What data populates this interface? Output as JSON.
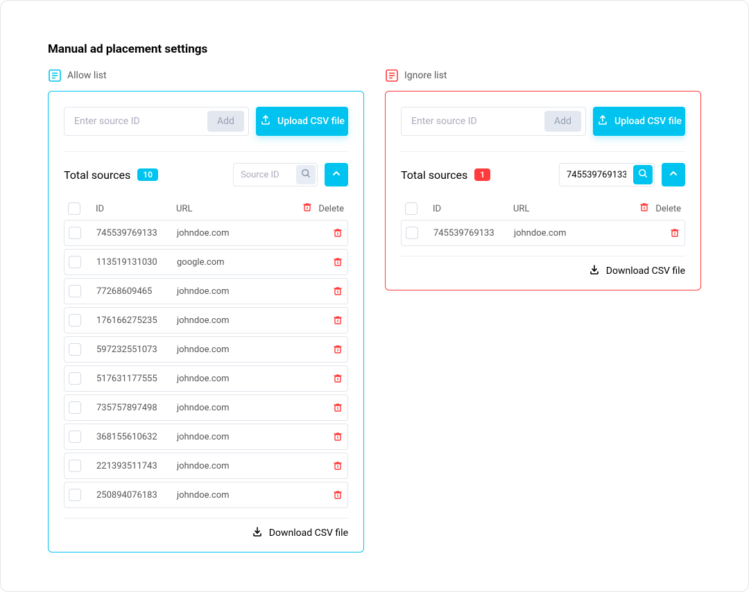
{
  "page": {
    "title": "Manual ad placement settings"
  },
  "labels": {
    "allow_list": "Allow list",
    "ignore_list": "Ignore list",
    "enter_source_placeholder": "Enter source ID",
    "add": "Add",
    "upload_csv": "Upload CSV file",
    "total_sources": "Total sources",
    "search_placeholder": "Source ID",
    "id": "ID",
    "url": "URL",
    "delete": "Delete",
    "download_csv": "Download CSV file"
  },
  "allow": {
    "count": "10",
    "search_value": "",
    "rows": [
      {
        "id": "745539769133",
        "url": "johndoe.com"
      },
      {
        "id": "113519131030",
        "url": "google.com"
      },
      {
        "id": "77268609465",
        "url": "johndoe.com"
      },
      {
        "id": "176166275235",
        "url": "johndoe.com"
      },
      {
        "id": "597232551073",
        "url": "johndoe.com"
      },
      {
        "id": "517631177555",
        "url": "johndoe.com"
      },
      {
        "id": "735757897498",
        "url": "johndoe.com"
      },
      {
        "id": "368155610632",
        "url": "johndoe.com"
      },
      {
        "id": "221393511743",
        "url": "johndoe.com"
      },
      {
        "id": "250894076183",
        "url": "johndoe.com"
      }
    ]
  },
  "ignore": {
    "count": "1",
    "search_value": "745539769133",
    "rows": [
      {
        "id": "745539769133",
        "url": "johndoe.com"
      }
    ]
  }
}
